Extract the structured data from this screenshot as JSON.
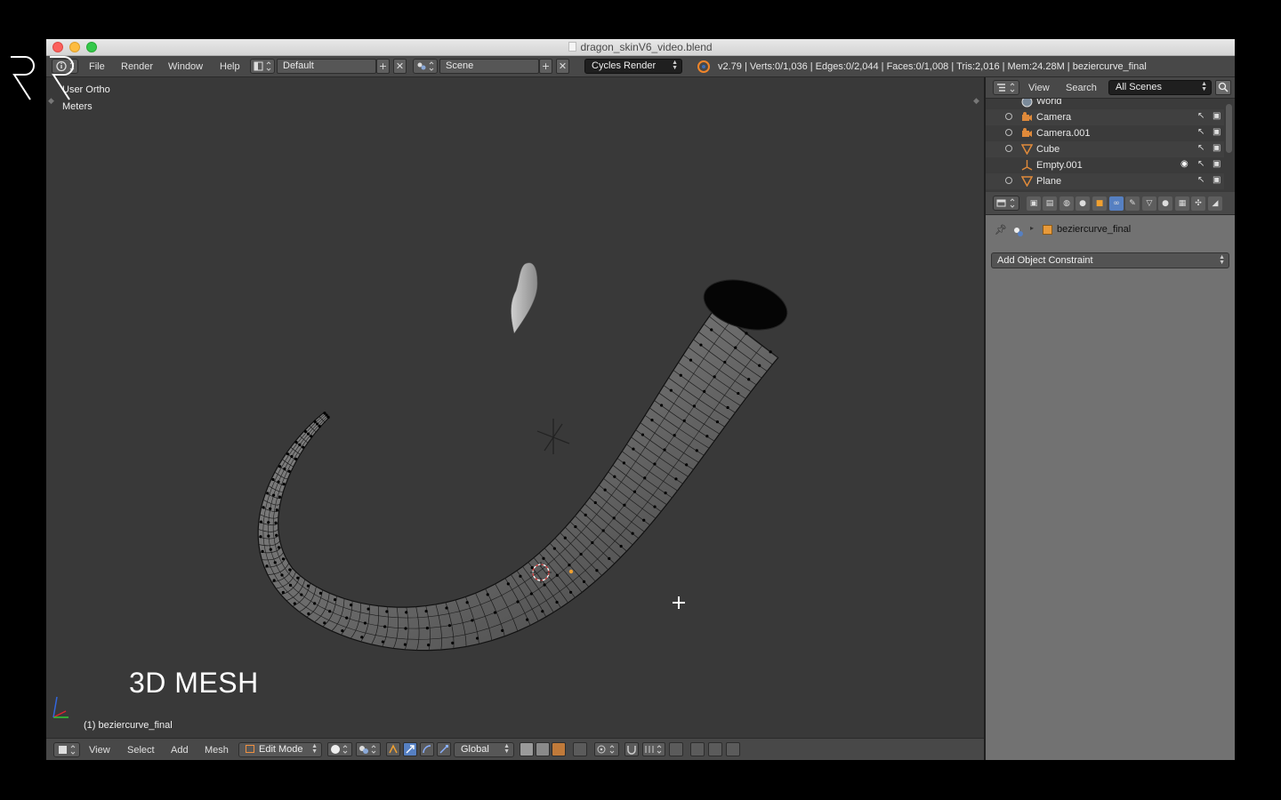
{
  "window": {
    "title": "dragon_skinV6_video.blend"
  },
  "info_header": {
    "menus": [
      "File",
      "Render",
      "Window",
      "Help"
    ],
    "screen_layout": "Default",
    "scene": "Scene",
    "render_engine": "Cycles Render",
    "stats": "v2.79 | Verts:0/1,036 | Edges:0/2,044 | Faces:0/1,008 | Tris:2,016 | Mem:24.28M | beziercurve_final"
  },
  "viewport": {
    "view_name": "User Ortho",
    "units": "Meters",
    "active_object_label": "(1) beziercurve_final",
    "overlay_caption": "3D MESH"
  },
  "viewport_footer": {
    "menus": [
      "View",
      "Select",
      "Add",
      "Mesh"
    ],
    "mode": "Edit Mode",
    "orientation": "Global"
  },
  "outliner": {
    "header_menus": [
      "View",
      "Search"
    ],
    "display_mode": "All Scenes",
    "items": [
      {
        "name": "World",
        "icon": "world-icon"
      },
      {
        "name": "Camera",
        "icon": "camera-icon"
      },
      {
        "name": "Camera.001",
        "icon": "camera-icon"
      },
      {
        "name": "Cube",
        "icon": "mesh-icon"
      },
      {
        "name": "Empty.001",
        "icon": "empty-icon"
      },
      {
        "name": "Plane",
        "icon": "mesh-icon"
      }
    ]
  },
  "properties": {
    "object_name": "beziercurve_final",
    "add_constraint_label": "Add Object Constraint"
  },
  "colors": {
    "accent_blue": "#5680c2",
    "orange": "#f0852a",
    "viewport_bg": "#393939"
  }
}
